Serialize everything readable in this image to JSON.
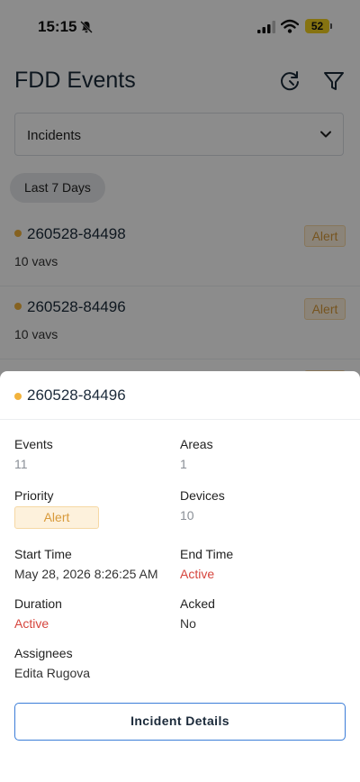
{
  "status_bar": {
    "time": "15:15",
    "battery": "52"
  },
  "header": {
    "title": "FDD Events"
  },
  "filter": {
    "selected": "Incidents",
    "date_chip": "Last 7 Days"
  },
  "list": [
    {
      "id": "260528-84498",
      "subtitle": "10 vavs",
      "badge": "Alert"
    },
    {
      "id": "260528-84496",
      "subtitle": "10 vavs",
      "badge": "Alert"
    }
  ],
  "sheet": {
    "id": "260528-84496",
    "events_label": "Events",
    "events_value": "11",
    "areas_label": "Areas",
    "areas_value": "1",
    "priority_label": "Priority",
    "priority_value": "Alert",
    "devices_label": "Devices",
    "devices_value": "10",
    "start_label": "Start Time",
    "start_value": "May 28, 2026 8:26:25 AM",
    "end_label": "End Time",
    "end_value": "Active",
    "duration_label": "Duration",
    "duration_value": "Active",
    "acked_label": "Acked",
    "acked_value": "No",
    "assignees_label": "Assignees",
    "assignees_value": "Edita Rugova",
    "button_label": "Incident Details"
  },
  "colors": {
    "alert": "#f2b33d",
    "active": "#d6453d",
    "button_border": "#3b7dd8"
  },
  "icons": [
    "bell-slash-icon",
    "signal-icon",
    "wifi-icon",
    "battery-icon",
    "refresh-icon",
    "filter-icon",
    "chevron-down-icon"
  ]
}
